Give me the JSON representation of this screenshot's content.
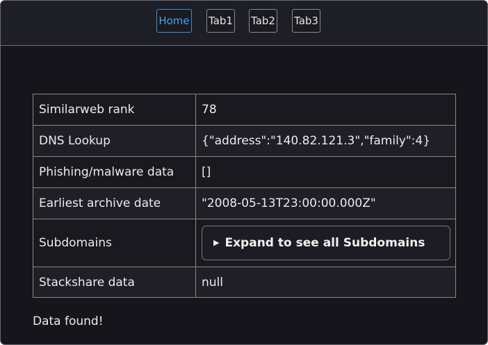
{
  "nav": {
    "tabs": [
      {
        "label": "Home",
        "active": true
      },
      {
        "label": "Tab1",
        "active": false
      },
      {
        "label": "Tab2",
        "active": false
      },
      {
        "label": "Tab3",
        "active": false
      }
    ]
  },
  "table": {
    "rows": [
      {
        "key": "Similarweb rank",
        "value": "78"
      },
      {
        "key": "DNS Lookup",
        "value": "{\"address\":\"140.82.121.3\",\"family\":4}"
      },
      {
        "key": "Phishing/malware data",
        "value": "[]"
      },
      {
        "key": "Earliest archive date",
        "value": "\"2008-05-13T23:00:00.000Z\""
      },
      {
        "key": "Subdomains",
        "button_label": "Expand to see all Subdomains",
        "button_icon": "triangle-right-icon"
      },
      {
        "key": "Stackshare data",
        "value": "null"
      }
    ]
  },
  "status_text": "Data found!",
  "colors": {
    "background": "#16151b",
    "topbar": "#1e1e26",
    "active_tab": "#4ea1ec",
    "border": "#8e8a7e"
  }
}
